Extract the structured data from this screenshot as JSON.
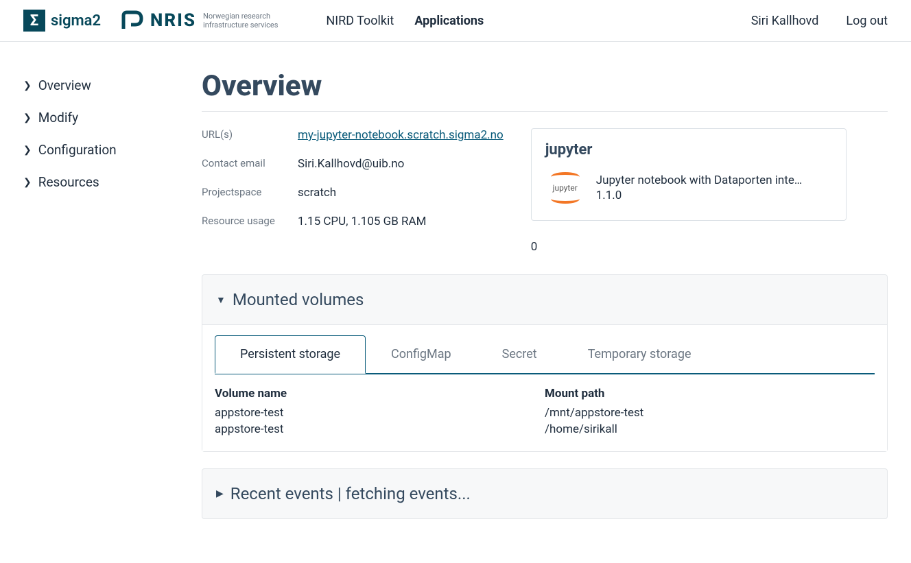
{
  "header": {
    "brand1": "sigma2",
    "brand2": "NRIS",
    "brand2_sub1": "Norwegian research",
    "brand2_sub2": "infrastructure services",
    "nav": [
      {
        "label": "NIRD Toolkit",
        "active": false
      },
      {
        "label": "Applications",
        "active": true
      }
    ],
    "user": "Siri Kallhovd",
    "logout": "Log out"
  },
  "sidebar": {
    "items": [
      {
        "label": "Overview"
      },
      {
        "label": "Modify"
      },
      {
        "label": "Configuration"
      },
      {
        "label": "Resources"
      }
    ]
  },
  "page": {
    "title": "Overview",
    "fields": {
      "urls_label": "URL(s)",
      "url": "my-jupyter-notebook.scratch.sigma2.no",
      "email_label": "Contact email",
      "email": "Siri.Kallhovd@uib.no",
      "projectspace_label": "Projectspace",
      "projectspace": "scratch",
      "resource_usage_label": "Resource usage",
      "resource_usage": "1.15 CPU, 1.105 GB RAM"
    },
    "package": {
      "name": "jupyter",
      "icon_text": "jupyter",
      "description": "Jupyter notebook with Dataporten inte…",
      "version": "1.1.0",
      "extra": "0"
    },
    "volumes": {
      "title": "Mounted volumes",
      "tabs": [
        {
          "label": "Persistent storage",
          "active": true
        },
        {
          "label": "ConfigMap",
          "active": false
        },
        {
          "label": "Secret",
          "active": false
        },
        {
          "label": "Temporary storage",
          "active": false
        }
      ],
      "columns": {
        "name": "Volume name",
        "path": "Mount path"
      },
      "rows": [
        {
          "name": "appstore-test",
          "path": "/mnt/appstore-test"
        },
        {
          "name": "appstore-test",
          "path": "/home/sirikall"
        }
      ]
    },
    "events": {
      "title": "Recent events | fetching events..."
    }
  }
}
